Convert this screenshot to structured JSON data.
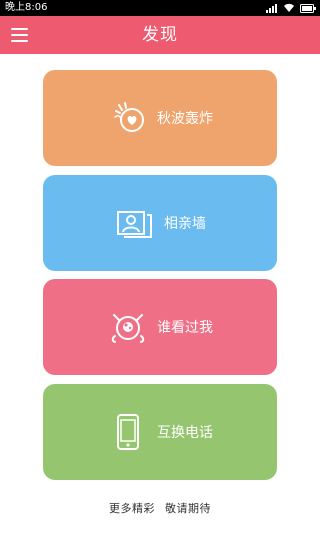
{
  "status_bar": {
    "time": "晚上8:06",
    "icons": [
      "signal-icon",
      "wifi-icon",
      "battery-icon"
    ]
  },
  "header": {
    "title": "发现",
    "menu_icon": "menu-icon"
  },
  "colors": {
    "header": "#ee5a6f",
    "card_orange": "#f0a46d",
    "card_blue": "#69bbf0",
    "card_pink": "#ef6f86",
    "card_green": "#95c66f"
  },
  "cards": [
    {
      "label": "秋波轰炸",
      "icon": "heart-wave-icon",
      "color": "#f0a46d"
    },
    {
      "label": "相亲墙",
      "icon": "photo-wall-icon",
      "color": "#69bbf0"
    },
    {
      "label": "谁看过我",
      "icon": "eye-creature-icon",
      "color": "#ef6f86"
    },
    {
      "label": "互换电话",
      "icon": "phone-icon",
      "color": "#95c66f"
    }
  ],
  "footer": {
    "text": "更多精彩 敬请期待"
  }
}
